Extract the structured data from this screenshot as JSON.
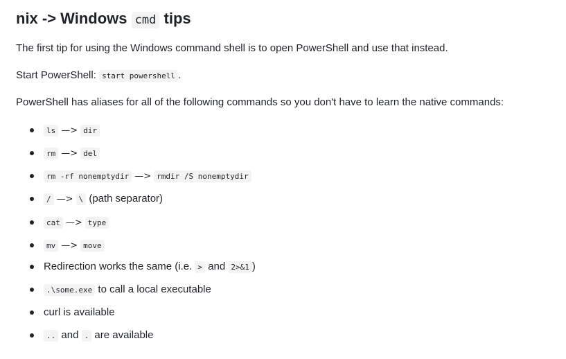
{
  "title": {
    "before": "nix -> Windows",
    "code": "cmd",
    "after": "tips"
  },
  "paragraphs": {
    "p1": "The first tip for using the Windows command shell is to open PowerShell and use that instead.",
    "p2_text": "Start PowerShell:",
    "p2_code": "start powershell",
    "p2_end": ".",
    "p3": "PowerShell has aliases for all of the following commands so you don't have to learn the native commands:"
  },
  "items": [
    {
      "left": "ls",
      "arrow": "—>",
      "right": "dir"
    },
    {
      "left": "rm",
      "arrow": "—>",
      "right": "del"
    },
    {
      "left": "rm -rf nonemptydir",
      "arrow": "—>",
      "right": "rmdir /S nonemptydir"
    },
    {
      "left": "/",
      "arrow": "—>",
      "right": "\\",
      "suffix": "(path separator)"
    },
    {
      "left": "cat",
      "arrow": "—>",
      "right": "type"
    },
    {
      "left": "mv",
      "arrow": "—>",
      "right": "move"
    },
    {
      "text1": "Redirection works the same (i.e.",
      "code1": ">",
      "text2": "and",
      "code2": "2>&1",
      "text3": ")"
    },
    {
      "code1": ".\\some.exe",
      "text1": "to call a local executable"
    },
    {
      "text1": "curl is available"
    },
    {
      "code1": "..",
      "text1": "and",
      "code2": ".",
      "text2": "are available"
    }
  ]
}
